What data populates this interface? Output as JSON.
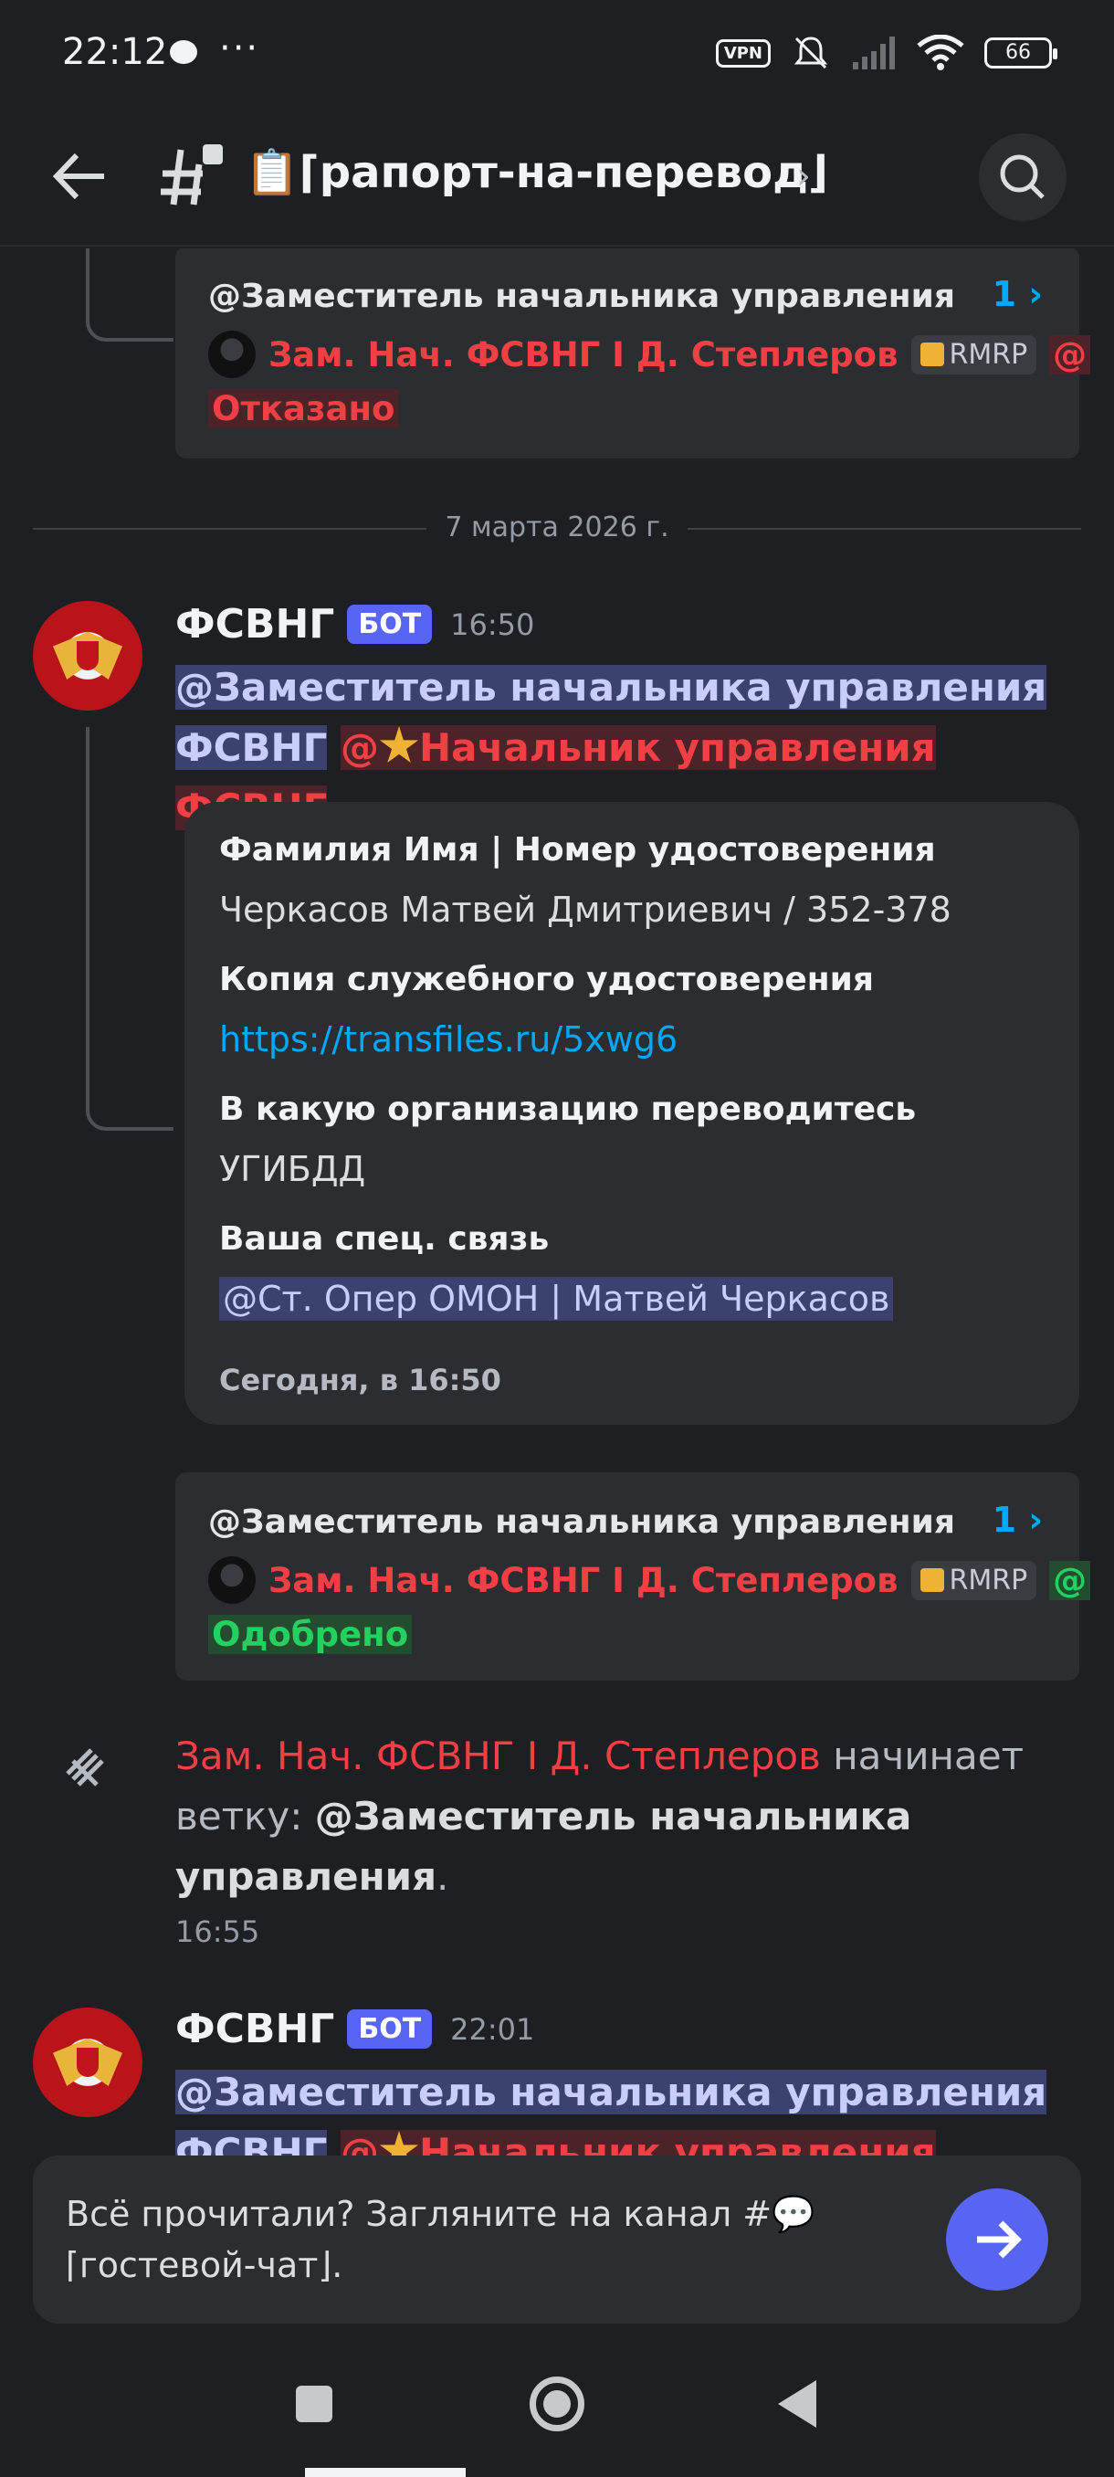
{
  "status_bar": {
    "time": "22:12",
    "dots": "···",
    "vpn": "VPN",
    "battery": "66"
  },
  "header": {
    "channel_title": "📋⌈рапорт-на-перевод⌋",
    "chevron": "›"
  },
  "thread_card_1": {
    "title": "@Заместитель начальника управления",
    "count": "1 ›",
    "author": "Зам. Нач. ФСВНГ I Д. Степлеров",
    "tag": "RMRP",
    "at": "@",
    "status": "Отказано"
  },
  "date_divider": "7 марта 2026 г.",
  "message_1": {
    "author": "ФСВНГ",
    "badge": "БОТ",
    "time": "16:50",
    "mention_1_line1": "@Заместитель начальника управления",
    "mention_1_line2": "ФСВНГ",
    "mention_2": "@",
    "mention_2_text": "Начальник управления ФСВНГ",
    "embed": {
      "field_1_name": "Фамилия Имя | Номер удостоверения",
      "field_1_value": "Черкасов Матвей Дмитриевич / 352-378",
      "field_2_name": "Копия служебного удостоверения",
      "field_2_value": "https://transfiles.ru/5xwg6",
      "field_3_name": "В какую организацию переводитесь",
      "field_3_value": "УГИБДД",
      "field_4_name": "Ваша спец. связь",
      "field_4_value": "@Ст. Опер ОМОН | Матвей Черкасов",
      "footer": "Сегодня, в 16:50"
    }
  },
  "thread_card_2": {
    "title": "@Заместитель начальника управления",
    "count": "1 ›",
    "author": "Зам. Нач. ФСВНГ I Д. Степлеров",
    "tag": "RMRP",
    "at": "@",
    "status": "Одобрено"
  },
  "system_message": {
    "actor": "Зам. Нач. ФСВНГ I Д. Степлеров",
    "text_1": " начинает ветку: ",
    "thread_name": "@Заместитель начальника управления",
    "text_2": ".",
    "time": "16:55"
  },
  "message_2": {
    "author": "ФСВНГ",
    "badge": "БОТ",
    "time": "22:01",
    "mention_1_line1": "@Заместитель начальника управления",
    "mention_1_line2": "ФСВНГ",
    "mention_2": "@",
    "mention_2_text": "Начальник управления ФСВНГ"
  },
  "prompt": {
    "text": "Всё прочитали? Загляните на канал #💬⌈гостевой-чат⌋."
  },
  "colors": {
    "background": "#1e1f22",
    "card": "#2b2d31",
    "accent": "#5865f2",
    "danger": "#f23f43",
    "success": "#23d160",
    "link": "#00a8fc"
  }
}
